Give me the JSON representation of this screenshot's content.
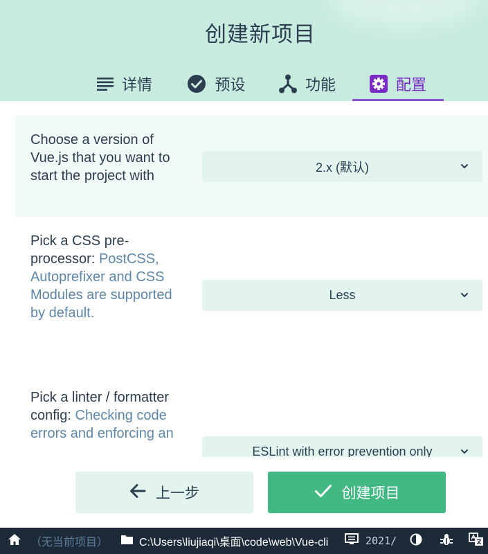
{
  "header": {
    "title": "创建新项目"
  },
  "tabs": [
    {
      "label": "详情",
      "icon": "list-icon",
      "active": false
    },
    {
      "label": "预设",
      "icon": "check-circle-icon",
      "active": false
    },
    {
      "label": "功能",
      "icon": "fork-icon",
      "active": false
    },
    {
      "label": "配置",
      "icon": "gear-icon",
      "active": true
    }
  ],
  "config": {
    "vue_version": {
      "prompt": "Choose a version of Vue.js that you want to start the project with",
      "value": "2.x (默认)"
    },
    "css_preprocessor": {
      "prompt": "Pick a CSS pre-processor:",
      "hint": "PostCSS, Autoprefixer and CSS Modules are supported by default.",
      "value": "Less"
    },
    "linter": {
      "prompt": "Pick a linter / formatter config:",
      "hint": "Checking code errors and enforcing an",
      "value": "ESLint with error prevention only"
    }
  },
  "footer": {
    "prev_label": "上一步",
    "create_label": "创建项目"
  },
  "statusbar": {
    "project": "（无当前项目）",
    "path": "C:\\Users\\liujiaqi\\桌面\\code\\web\\Vue-cli",
    "log": "2021/"
  },
  "colors": {
    "header_bg": "#c8ebdf",
    "accent_purple": "#8a4fd6",
    "primary_green": "#42b983",
    "statusbar_bg": "#1d2b39"
  }
}
